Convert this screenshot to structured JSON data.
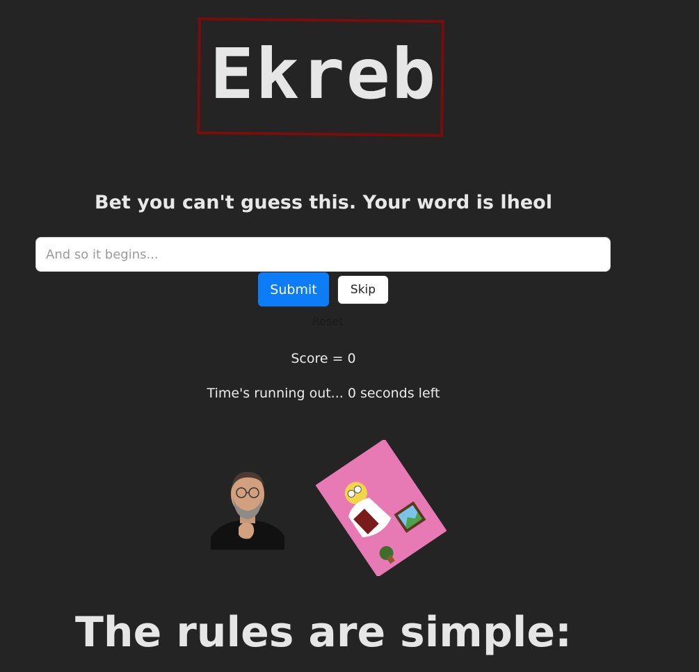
{
  "logo": {
    "text": "Ekreb",
    "frame_color": "#7a0c0c"
  },
  "prompt": {
    "text": "Bet you can't guess this. Your word is lheol"
  },
  "guess_input": {
    "placeholder": "And so it begins...",
    "value": ""
  },
  "buttons": {
    "submit_label": "Submit",
    "skip_label": "Skip",
    "reset_label": "Reset"
  },
  "status": {
    "score_text": "Score = 0",
    "timer_text": "Time's running out... 0 seconds left"
  },
  "images": {
    "person_icon": "person-photo",
    "card_icon": "cartoon-card-photo"
  },
  "rules": {
    "heading": "The rules are simple:"
  },
  "colors": {
    "background": "#242424",
    "accent": "#0d7df7",
    "text": "#e8e8e8"
  }
}
